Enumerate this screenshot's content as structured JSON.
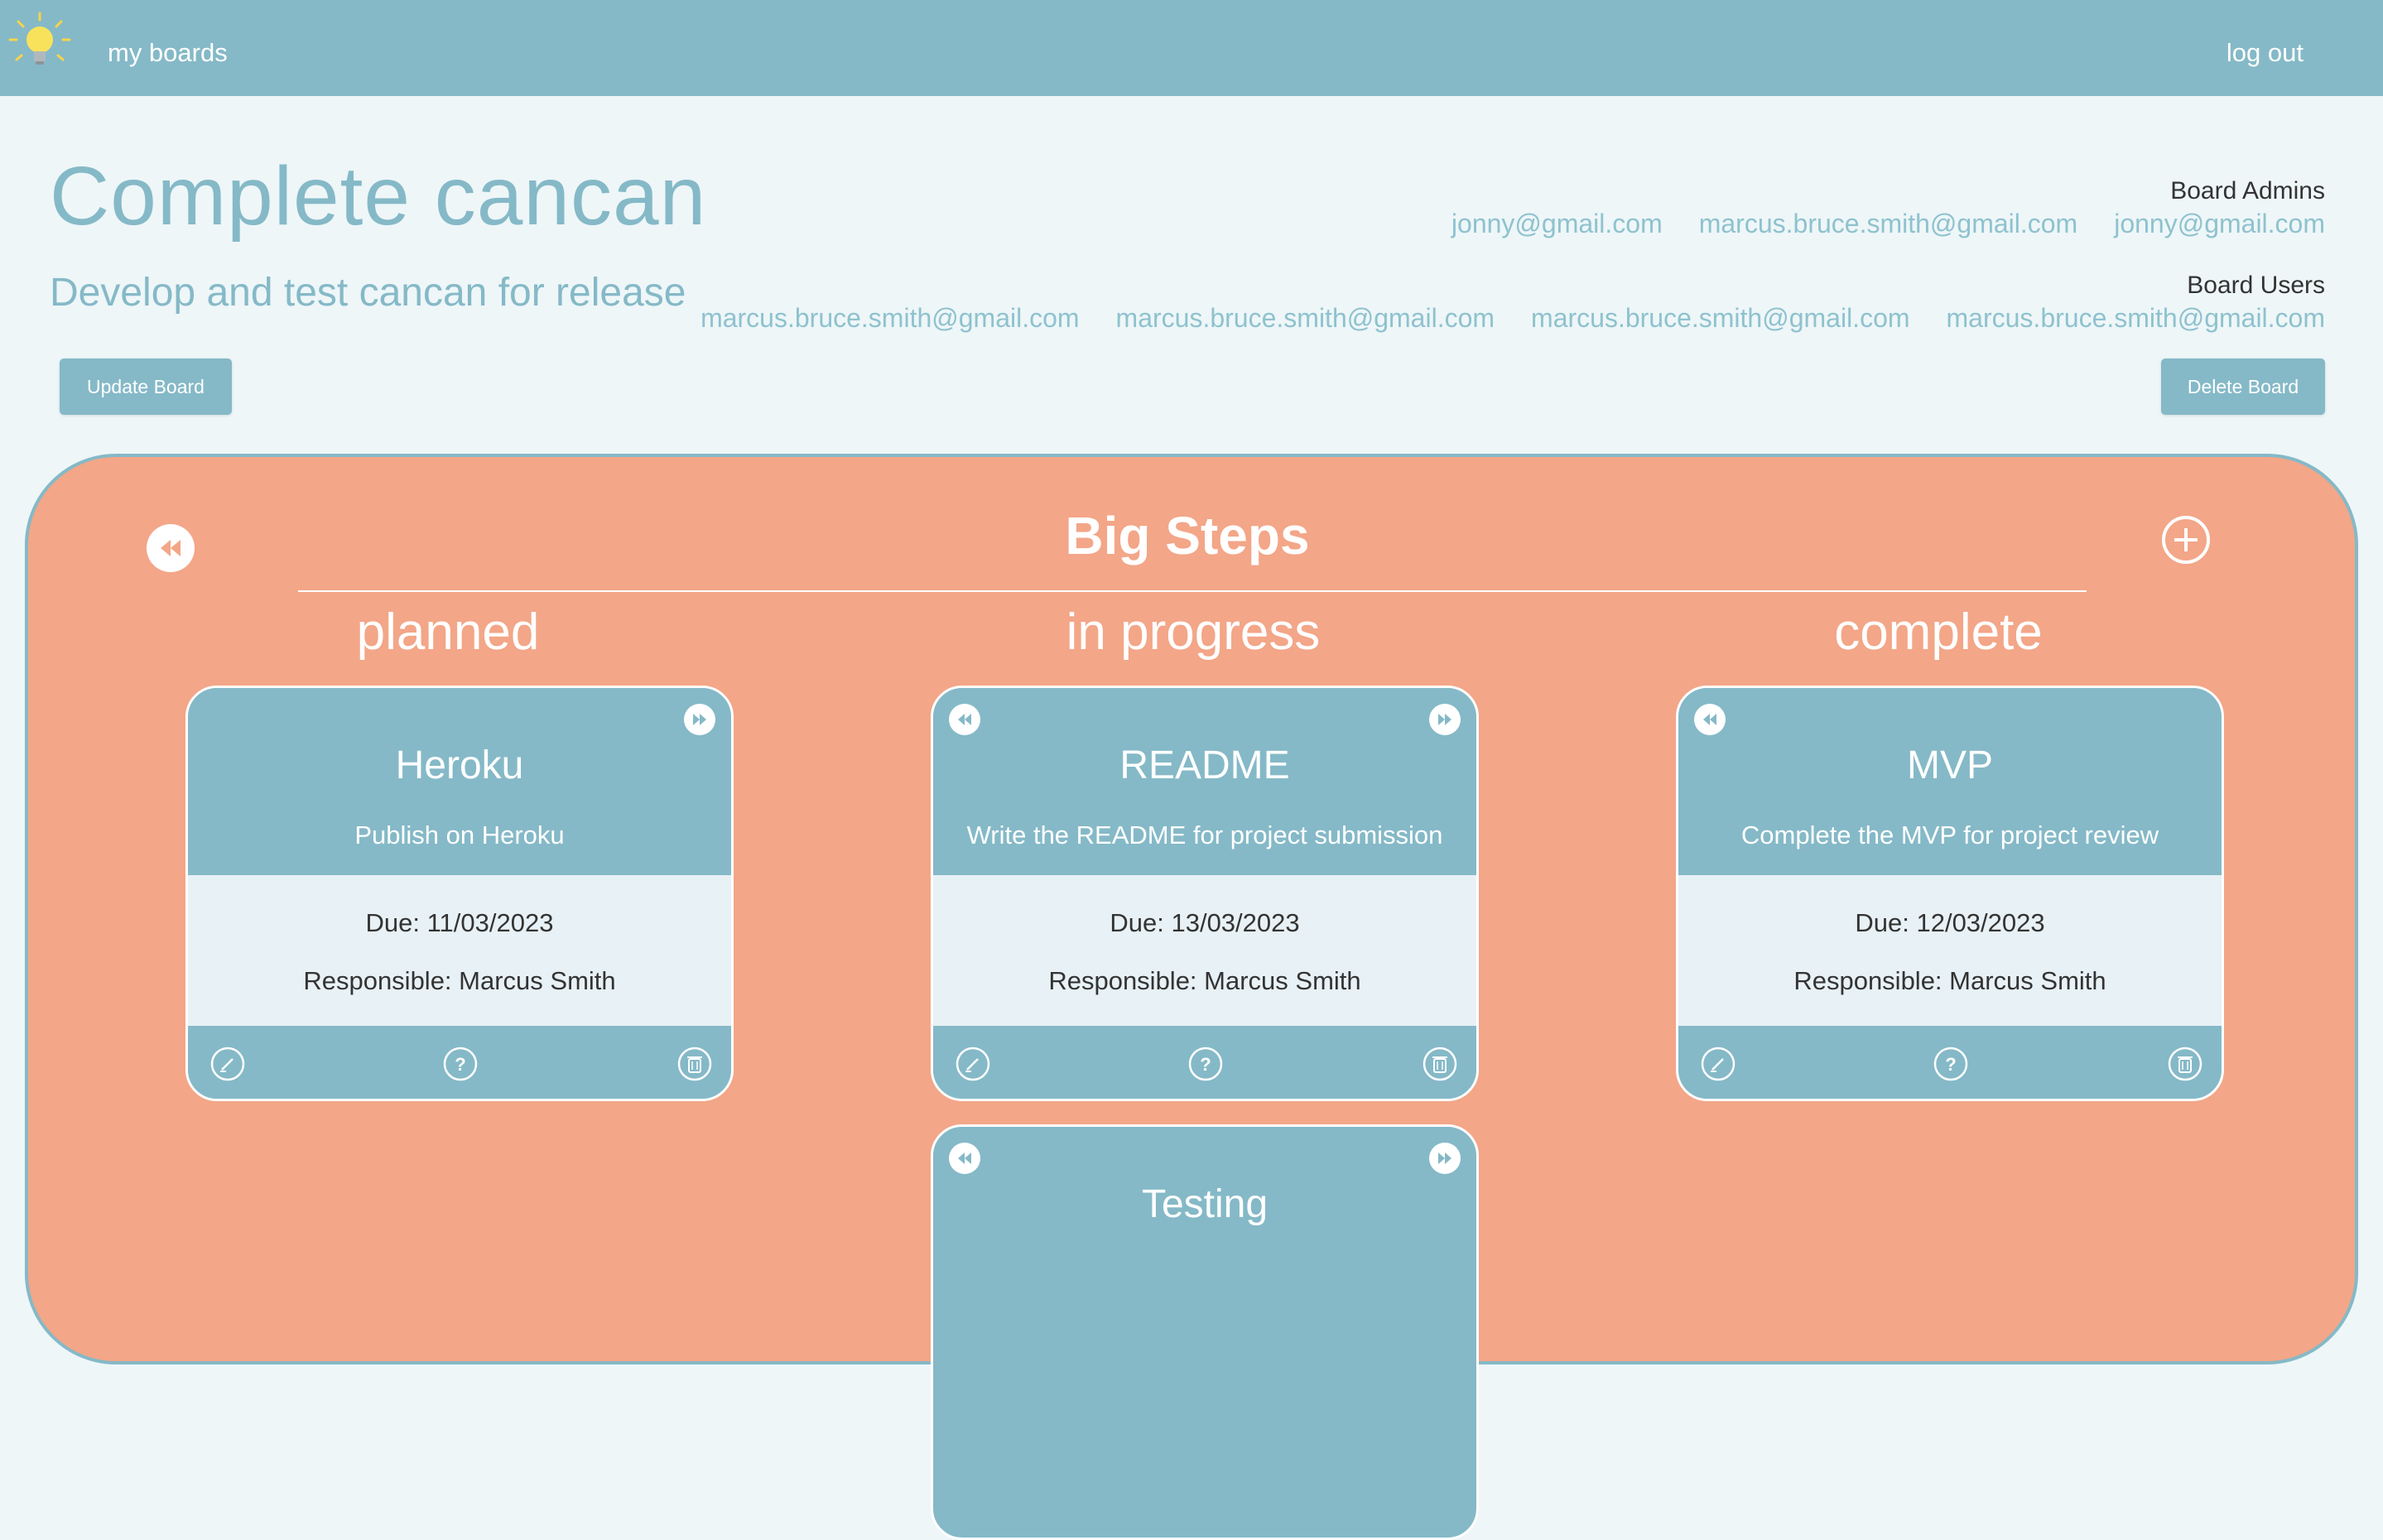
{
  "nav": {
    "my_boards": "my boards",
    "log_out": "log out"
  },
  "board": {
    "title": "Complete cancan",
    "description": "Develop and test cancan for release",
    "update_label": "Update Board",
    "delete_label": "Delete Board",
    "admins_label": "Board Admins",
    "admins": [
      "jonny@gmail.com",
      "marcus.bruce.smith@gmail.com",
      "jonny@gmail.com"
    ],
    "users_label": "Board Users",
    "users": [
      "marcus.bruce.smith@gmail.com",
      "marcus.bruce.smith@gmail.com",
      "marcus.bruce.smith@gmail.com",
      "marcus.bruce.smith@gmail.com"
    ]
  },
  "steps": {
    "title": "Big Steps",
    "columns": [
      "planned",
      "in progress",
      "complete"
    ]
  },
  "cards": [
    {
      "title": "Heroku",
      "description": "Publish on Heroku",
      "due": "Due: 11/03/2023",
      "responsible": "Responsible: Marcus Smith"
    },
    {
      "title": "README",
      "description": "Write the README for project submission",
      "due": "Due: 13/03/2023",
      "responsible": "Responsible: Marcus Smith"
    },
    {
      "title": "MVP",
      "description": "Complete the MVP for project review",
      "due": "Due: 12/03/2023",
      "responsible": "Responsible: Marcus Smith"
    },
    {
      "title": "Testing"
    }
  ],
  "colors": {
    "teal": "#85b9c7",
    "salmon": "#f3a688",
    "page": "#eef6f8",
    "card_mid": "#e8f1f5"
  },
  "icons": [
    "lightbulb-icon",
    "rewind-icon",
    "plus-circle-icon",
    "fast-forward-icon",
    "pencil-icon",
    "question-icon",
    "trash-icon"
  ]
}
